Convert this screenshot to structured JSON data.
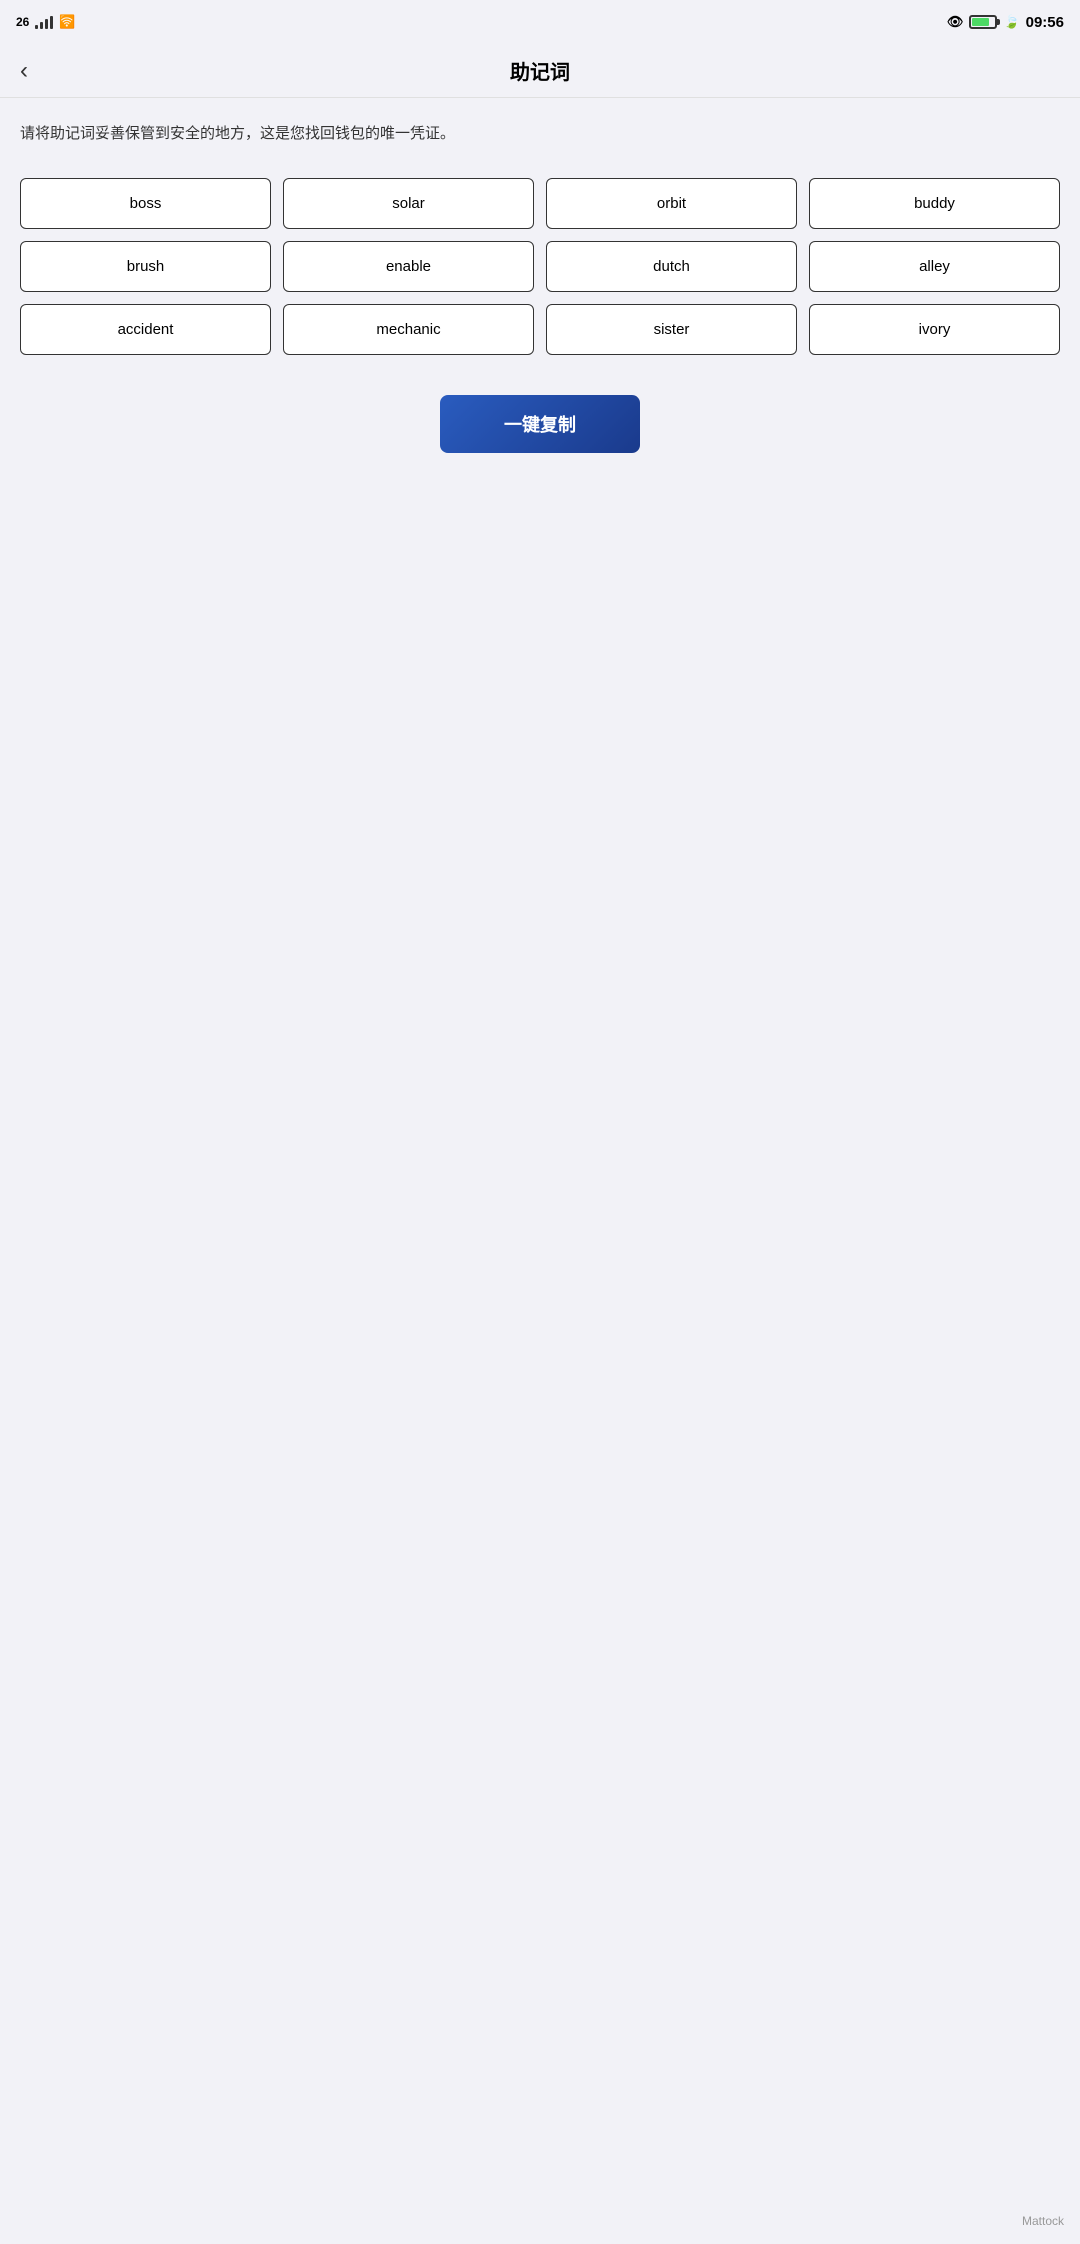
{
  "status_bar": {
    "network": "26",
    "time": "09:56"
  },
  "header": {
    "back_label": "‹",
    "title": "助记词"
  },
  "description": "请将助记词妥善保管到安全的地方，这是您找回钱包的唯一凭证。",
  "words": [
    "boss",
    "solar",
    "orbit",
    "buddy",
    "brush",
    "enable",
    "dutch",
    "alley",
    "accident",
    "mechanic",
    "sister",
    "ivory"
  ],
  "copy_button_label": "一键复制",
  "watermark": "Mattock"
}
